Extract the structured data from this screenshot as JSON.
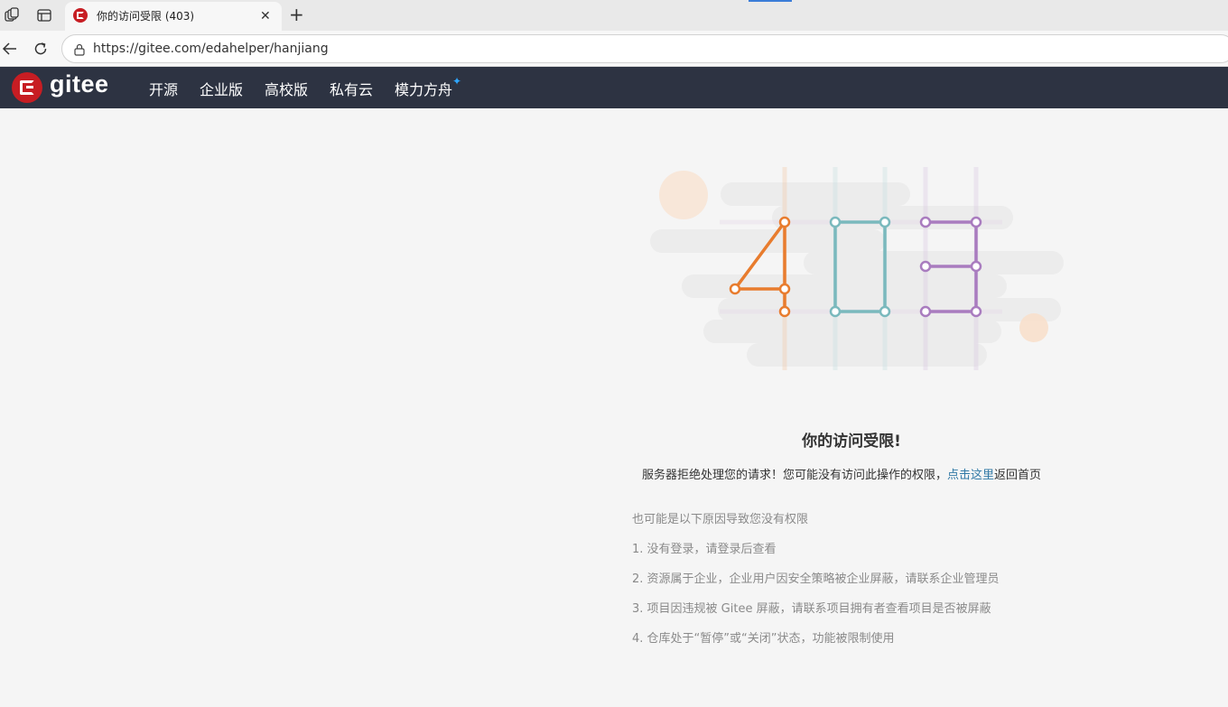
{
  "browser": {
    "tab_title": "你的访问受限 (403)",
    "tab_close": "✕",
    "new_tab": "+",
    "url": "https://gitee.com/edahelper/hanjiang"
  },
  "header": {
    "logo_text": "gitee",
    "nav": [
      "开源",
      "企业版",
      "高校版",
      "私有云",
      "模力方舟"
    ],
    "star": "✦",
    "colors": {
      "bg": "#2d3342",
      "logo": "#c71d23",
      "star": "#2ea7ff"
    }
  },
  "error": {
    "code_digits": [
      "4",
      "0",
      "3"
    ],
    "digit_colors": [
      "#e87c2e",
      "#7ab9bd",
      "#a97cbf"
    ],
    "title": "你的访问受限!",
    "desc_prefix": "服务器拒绝处理您的请求！您可能没有访问此操作的权限，",
    "desc_link": "点击这里",
    "desc_suffix": "返回首页",
    "reasons_heading": "也可能是以下原因导致您没有权限",
    "reasons": [
      "1. 没有登录，请登录后查看",
      "2. 资源属于企业，企业用户因安全策略被企业屏蔽，请联系企业管理员",
      "3. 项目因违规被 Gitee 屏蔽，请联系项目拥有者查看项目是否被屏蔽",
      "4. 仓库处于“暂停”或“关闭”状态，功能被限制使用"
    ]
  }
}
